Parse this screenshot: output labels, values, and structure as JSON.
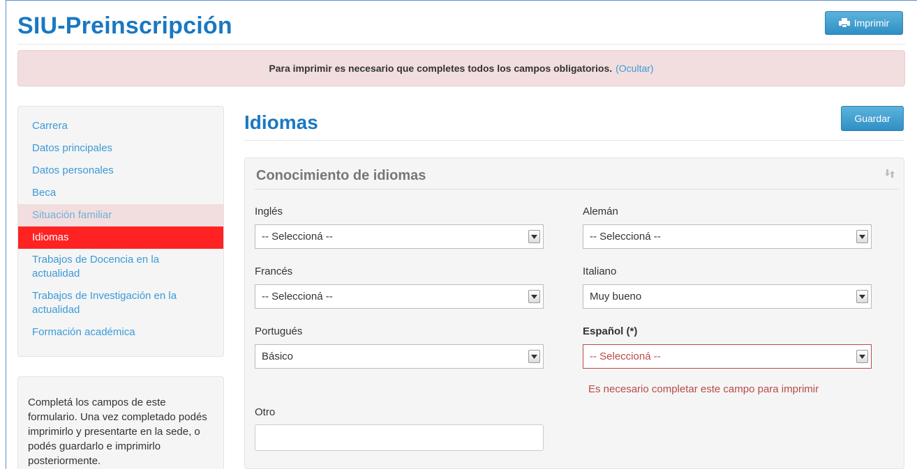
{
  "header": {
    "app_title": "SIU-Preinscripción",
    "print_label": "Imprimir"
  },
  "alert": {
    "message": "Para imprimir es necesario que completes todos los campos obligatorios.",
    "hide_link": "(Ocultar)"
  },
  "sidebar": {
    "items": [
      {
        "label": "Carrera"
      },
      {
        "label": "Datos principales"
      },
      {
        "label": "Datos personales"
      },
      {
        "label": "Beca"
      },
      {
        "label": "Situación familiar"
      },
      {
        "label": "Idiomas"
      },
      {
        "label": "Trabajos de Docencia en la actualidad"
      },
      {
        "label": "Trabajos de Investigación en la actualidad"
      },
      {
        "label": "Formación académica"
      }
    ],
    "active_item": "Idiomas"
  },
  "help": {
    "text": "Completá los campos de este formulario. Una vez completado podés imprimirlo y presentarte en la sede, o podés guardarlo e imprimirlo posteriormente."
  },
  "main": {
    "page_title": "Idiomas",
    "save_label": "Guardar",
    "panel_title": "Conocimiento de idiomas",
    "fields": {
      "ingles": {
        "label": "Inglés",
        "value": "-- Seleccioná --"
      },
      "aleman": {
        "label": "Alemán",
        "value": "-- Seleccioná --"
      },
      "frances": {
        "label": "Francés",
        "value": "-- Seleccioná --"
      },
      "italiano": {
        "label": "Italiano",
        "value": "Muy bueno"
      },
      "portugues": {
        "label": "Portugués",
        "value": "Básico"
      },
      "espanol": {
        "label": "Español (*)",
        "value": "-- Seleccioná --",
        "error": "Es necesario completar este campo para imprimir"
      },
      "otro": {
        "label": "Otro",
        "value": ""
      }
    }
  },
  "colors": {
    "brand_blue": "#1a78c2",
    "link_blue": "#3a9ad9",
    "active_red": "#ff2222",
    "error_red": "#b94a48",
    "alert_bg": "#f2dede"
  }
}
